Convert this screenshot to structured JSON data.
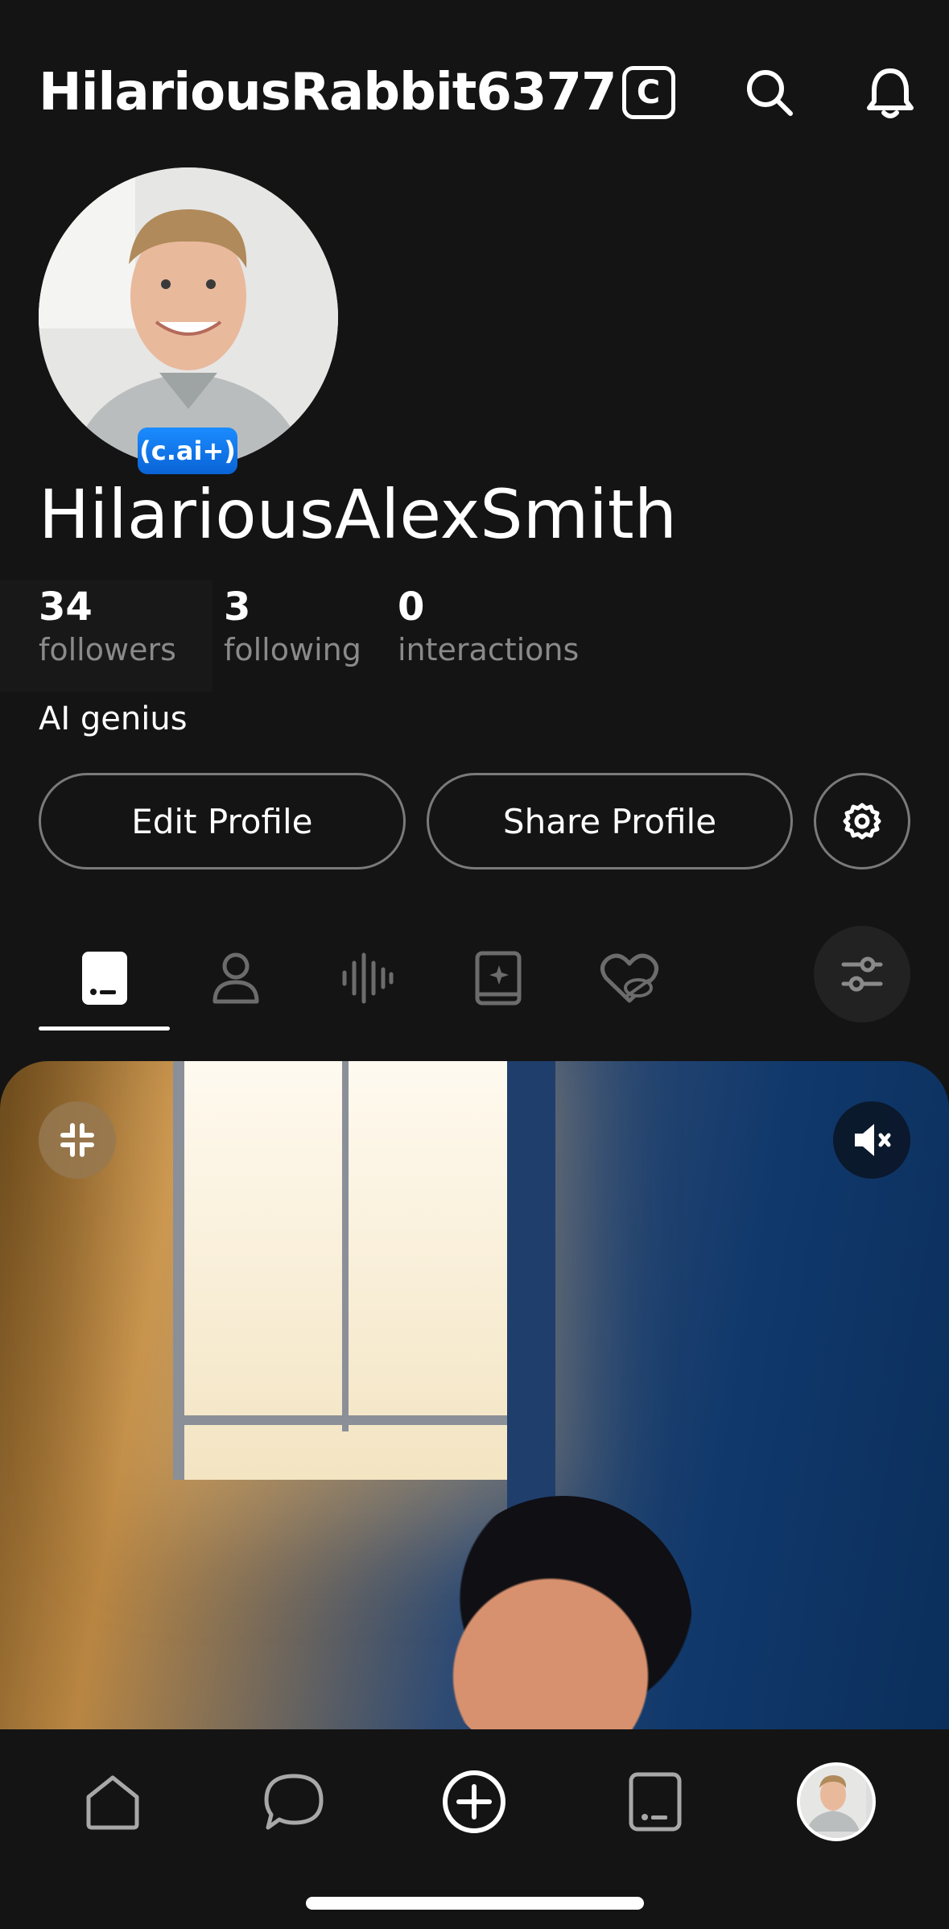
{
  "header": {
    "username": "HilariousRabbit6377",
    "icons": [
      "c-badge-icon",
      "search-icon",
      "bell-icon"
    ],
    "c_badge_label": "C"
  },
  "profile": {
    "badge": "(c.ai+)",
    "display_name": "HilariousAlexSmith",
    "bio": "AI genius",
    "stats": [
      {
        "value": "34",
        "label": "followers"
      },
      {
        "value": "3",
        "label": "following"
      },
      {
        "value": "0",
        "label": "interactions"
      }
    ]
  },
  "buttons": {
    "edit": "Edit Profile",
    "share": "Share Profile"
  },
  "tabs": [
    "characters-tab",
    "personas-tab",
    "voices-tab",
    "books-tab",
    "liked-tab",
    "filter"
  ],
  "colors": {
    "background": "#141414",
    "accent_blue": "#0a63d6",
    "muted_text": "#8a8a8a"
  }
}
